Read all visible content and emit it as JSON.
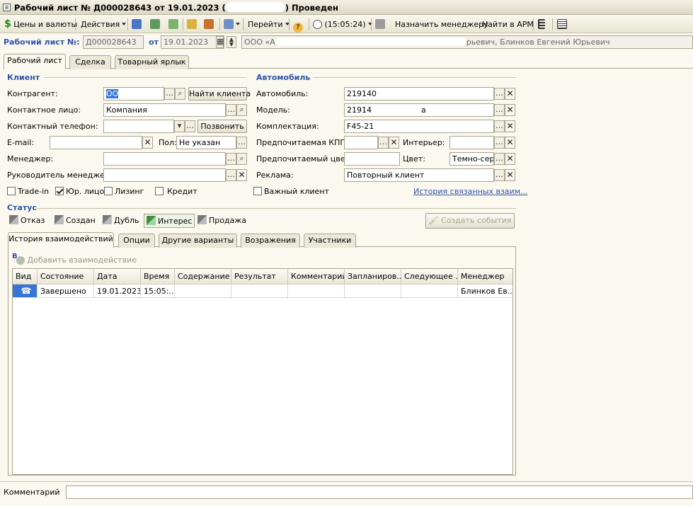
{
  "window": {
    "title": "Рабочий лист № Д000028643 от 19.01.2023 (",
    "title_suffix": ") Проведен"
  },
  "toolbar": {
    "prices": "Цены и валюты",
    "actions": "Действия",
    "go": "Перейти",
    "time": "(15:05:24)",
    "assign": "Назначить менеджеру",
    "find_arm": "Найти в АРМ"
  },
  "header": {
    "label": "Рабочий лист №:",
    "number": "Д000028643",
    "from_label": "от",
    "date": "19.01.2023",
    "org": "ООО «А",
    "org_tail": "рьевич, Блинков Евгений Юрьевич"
  },
  "tabs": [
    "Рабочий лист",
    "Сделка",
    "Товарный ярлык"
  ],
  "client": {
    "section": "Клиент",
    "counterparty_label": "Контрагент:",
    "counterparty_value": "ОО",
    "find_client": "Найти клиента",
    "contact_label": "Контактное лицо:",
    "contact_value": "Компания",
    "phone_label": "Контактный телефон:",
    "call": "Позвонить",
    "email_label": "E-mail:",
    "gender_label": "Пол:",
    "gender_value": "Не указан",
    "manager_label": "Менеджер:",
    "head_label": "Руководитель менеджер",
    "checks": [
      {
        "label": "Trade-in",
        "checked": false
      },
      {
        "label": "Юр. лицо",
        "checked": true
      },
      {
        "label": "Лизинг",
        "checked": false
      },
      {
        "label": "Кредит",
        "checked": false
      }
    ]
  },
  "car": {
    "section": "Автомобиль",
    "car_label": "Автомобиль:",
    "car_value": "219140",
    "model_label": "Модель:",
    "model_value": "21914",
    "model_tail": "а",
    "equip_label": "Комплектация:",
    "equip_value": "F45-21",
    "gearbox_label": "Предпочитаемая КПП:",
    "interior_label": "Интерьер:",
    "color_pref_label": "Предпочитаемый цвет:",
    "color_label": "Цвет:",
    "color_value": "Темно-серы",
    "ad_label": "Реклама:",
    "ad_value": "Повторный клиент",
    "important_label": "Важный клиент",
    "history_link": "История связанных взаим..."
  },
  "status": {
    "section": "Статус",
    "buttons": [
      "Отказ",
      "Создан",
      "Дубль",
      "Интерес",
      "Продажа"
    ],
    "active": "Интерес",
    "create_events": "Создать события"
  },
  "subtabs": [
    "История взаимодействий",
    "Опции",
    "Другие варианты",
    "Возражения",
    "Участники"
  ],
  "history": {
    "add": "Добавить взаимодействие",
    "columns": [
      "Вид",
      "Состояние",
      "Дата",
      "Время",
      "Содержание",
      "Результат",
      "Комментарий",
      "Запланиров...",
      "Следующее ...",
      "Менеджер"
    ],
    "rows": [
      {
        "state": "Завершено",
        "date": "19.01.2023",
        "time": "15:05:...",
        "content": "",
        "result": "",
        "comment": "",
        "planned": "",
        "next": "",
        "manager": "Блинков Ев..."
      }
    ]
  },
  "footer": {
    "comment_label": "Комментарий"
  }
}
